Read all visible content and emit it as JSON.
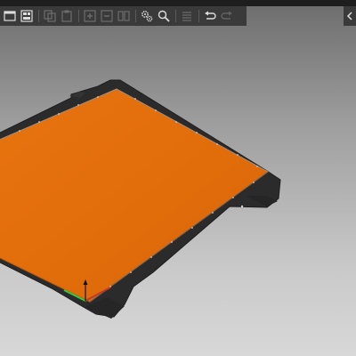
{
  "window": {
    "title": "",
    "bed_color": "#e56d09",
    "frame_color": "#2b2b2b",
    "background_top": "#6c6c6c",
    "background_bottom": "#d8d8d8"
  },
  "toolbar": {
    "buttons": [
      {
        "name": "add-button",
        "icon": "add-icon",
        "enabled": true
      },
      {
        "name": "arrange-button",
        "icon": "arrange-icon",
        "enabled": true
      },
      {
        "name": "copy-button",
        "icon": "copy-icon",
        "enabled": false
      },
      {
        "name": "paste-button",
        "icon": "paste-icon",
        "enabled": false
      },
      {
        "name": "instance-add-button",
        "icon": "plus-box-icon",
        "enabled": false
      },
      {
        "name": "instance-remove-button",
        "icon": "minus-box-icon",
        "enabled": false
      },
      {
        "name": "split-button",
        "icon": "split-icon",
        "enabled": false
      },
      {
        "name": "settings-button",
        "icon": "gears-icon",
        "enabled": true
      },
      {
        "name": "search-button",
        "icon": "search-icon",
        "enabled": true
      },
      {
        "name": "layers-button",
        "icon": "layers-icon",
        "enabled": false
      },
      {
        "name": "undo-button",
        "icon": "undo-icon",
        "enabled": true
      },
      {
        "name": "redo-button",
        "icon": "redo-icon",
        "enabled": false
      }
    ]
  },
  "sidebar_toggle": {
    "icon": "chevron-left-icon"
  }
}
